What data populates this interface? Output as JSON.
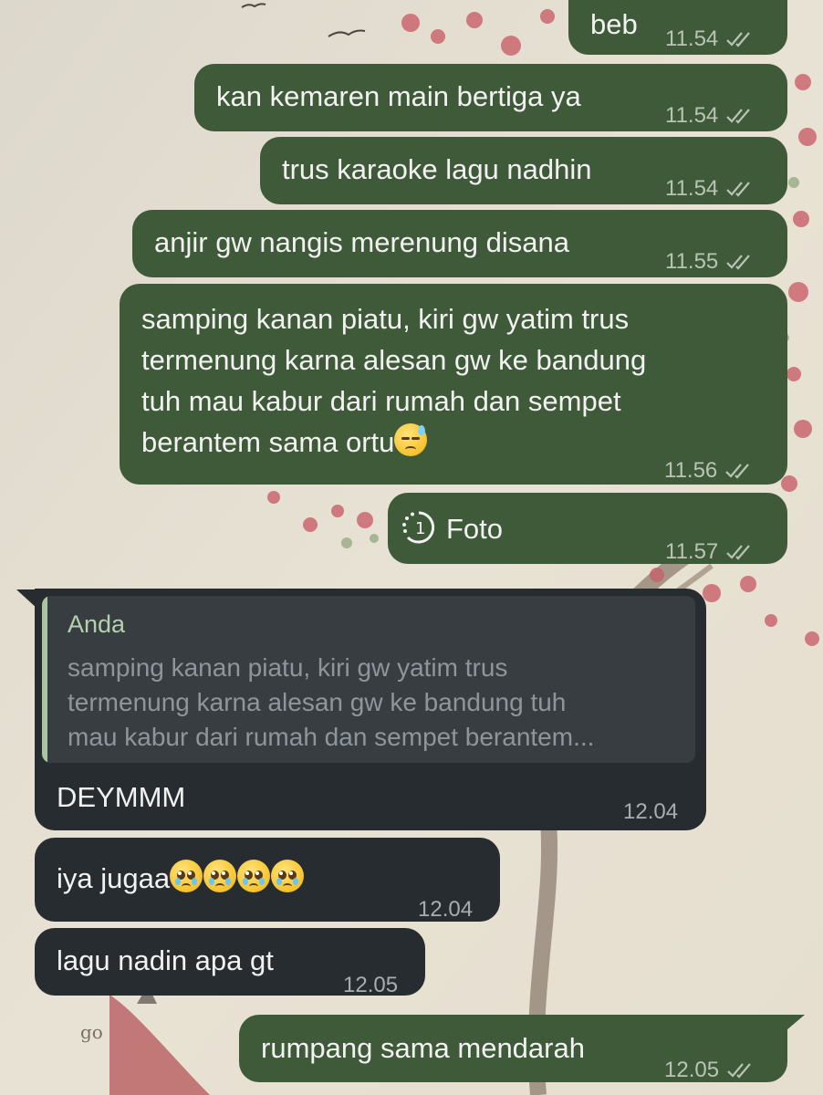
{
  "messages": [
    {
      "id": "m1",
      "direction": "outgoing",
      "text": "beb",
      "time": "11.54",
      "status": "read"
    },
    {
      "id": "m2",
      "direction": "outgoing",
      "text": "kan kemaren main bertiga ya",
      "time": "11.54",
      "status": "read"
    },
    {
      "id": "m3",
      "direction": "outgoing",
      "text": "trus karaoke lagu nadhin",
      "time": "11.54",
      "status": "read"
    },
    {
      "id": "m4",
      "direction": "outgoing",
      "text": "anjir gw nangis merenung disana",
      "time": "11.55",
      "status": "read"
    },
    {
      "id": "m5",
      "direction": "outgoing",
      "lines": [
        "samping kanan piatu, kiri gw yatim trus",
        "termenung karna alesan gw ke bandung",
        "tuh mau kabur dari rumah dan sempet",
        "berantem sama ortu"
      ],
      "emoji": "sad-but-relieved-face",
      "time": "11.56",
      "status": "read"
    },
    {
      "id": "m6",
      "direction": "outgoing",
      "type": "view-once-photo",
      "text": "Foto",
      "time": "11.57",
      "status": "read"
    },
    {
      "id": "m7",
      "direction": "incoming",
      "quote": {
        "author": "Anda",
        "lines": [
          "samping kanan piatu, kiri gw yatim trus",
          "termenung karna alesan gw ke bandung tuh",
          "mau kabur dari rumah dan sempet berantem..."
        ]
      },
      "text": "DEYMMM",
      "time": "12.04"
    },
    {
      "id": "m8",
      "direction": "incoming",
      "text": "iya jugaa",
      "emoji": "pleading-face",
      "emoji_count": 4,
      "time": "12.04"
    },
    {
      "id": "m9",
      "direction": "incoming",
      "text": "lagu nadin apa gt",
      "time": "12.05"
    },
    {
      "id": "m10",
      "direction": "outgoing",
      "text": "rumpang sama mendarah",
      "time": "12.05",
      "status": "read"
    }
  ],
  "colors": {
    "outgoing_bubble": "#3f5a38",
    "incoming_bubble": "#272c30",
    "quote_bar": "#a9c6a0",
    "read_tick": "#b9c4b4"
  }
}
